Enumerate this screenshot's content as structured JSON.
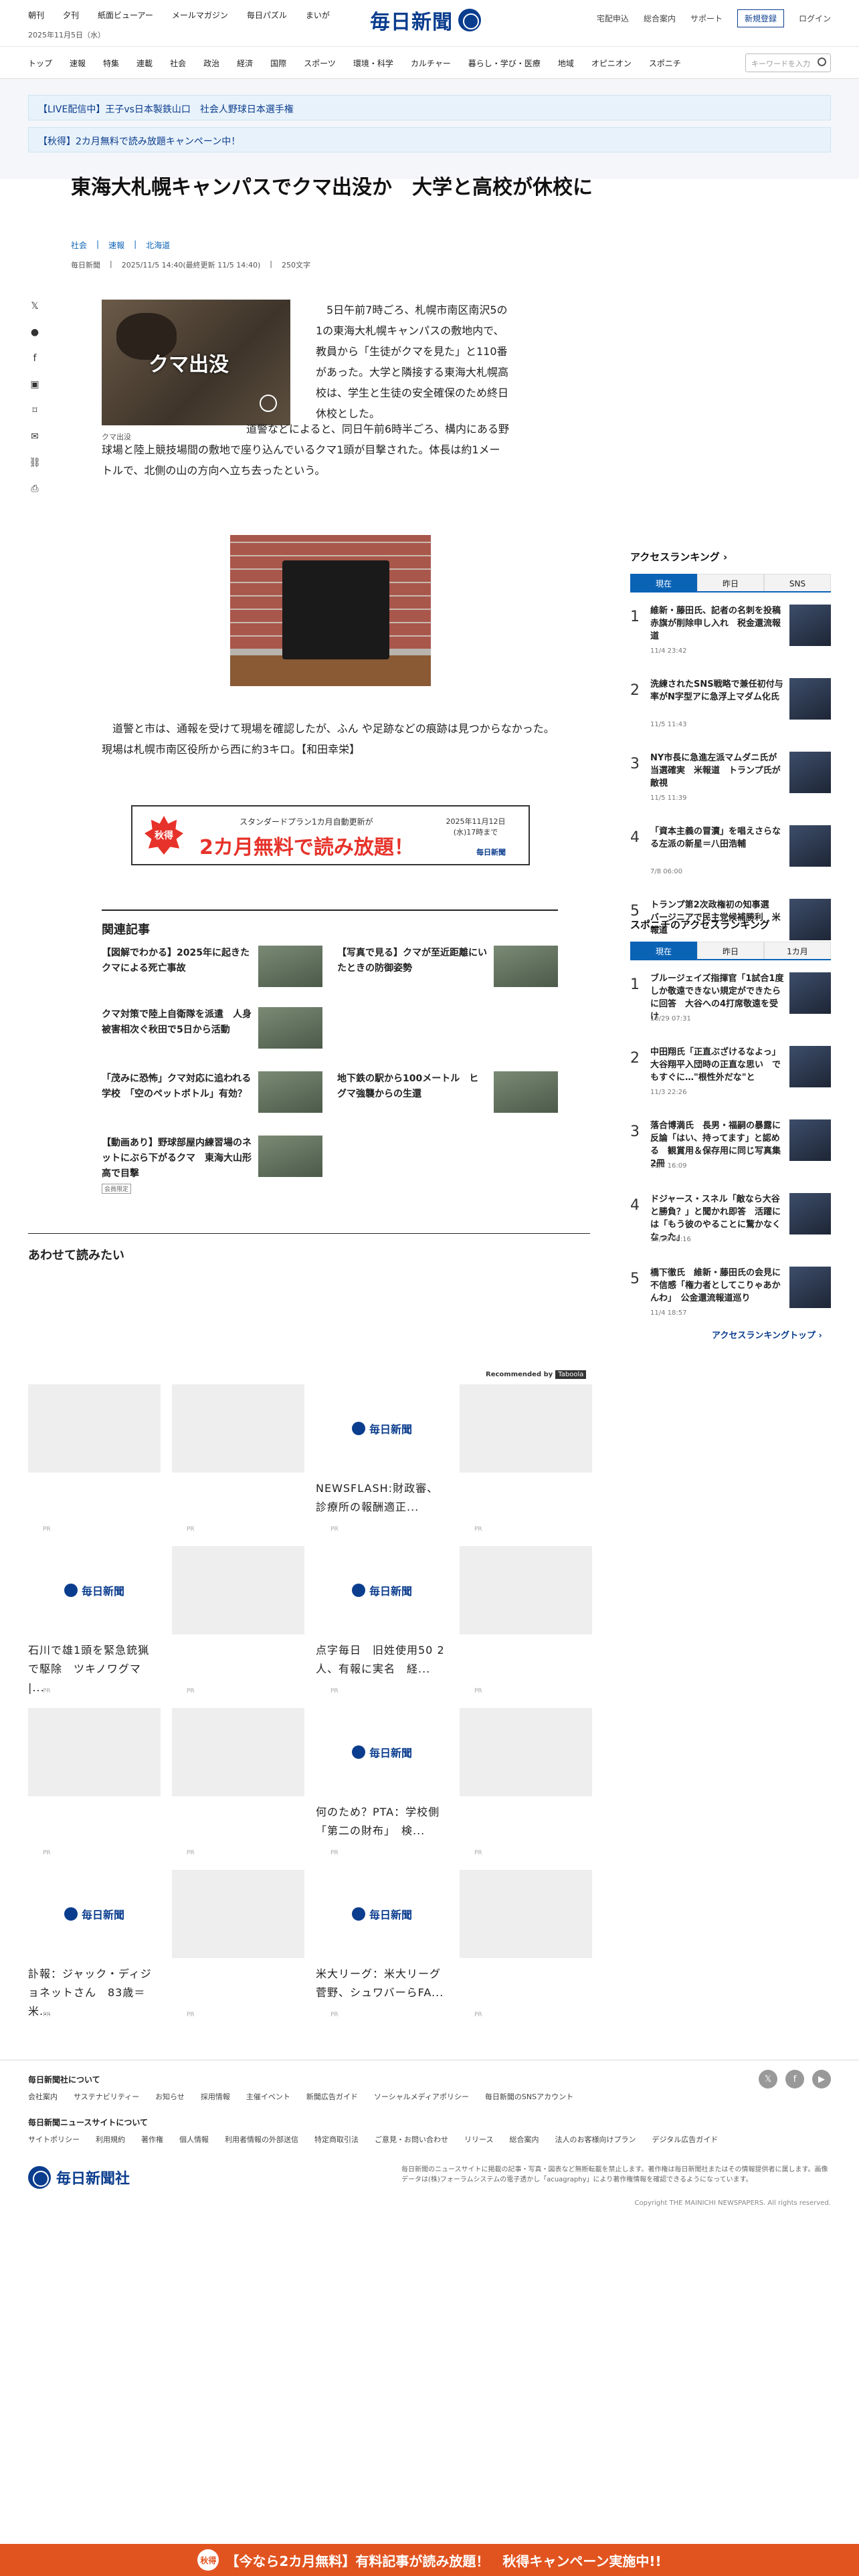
{
  "header": {
    "top_links": [
      "朝刊",
      "夕刊",
      "紙面ビューアー",
      "メールマガジン",
      "毎日パズル",
      "まいが"
    ],
    "date": "2025年11月5日（水）",
    "logo_text": "毎日新聞",
    "right_links": [
      "宅配申込",
      "総合案内",
      "サポート"
    ],
    "register": "新規登録",
    "login": "ログイン"
  },
  "nav": {
    "categories": [
      "トップ",
      "速報",
      "特集",
      "連載",
      "社会",
      "政治",
      "経済",
      "国際",
      "スポーツ",
      "環境・科学",
      "カルチャー",
      "暮らし・学び・医療",
      "地域",
      "オピニオン",
      "スポニチ"
    ],
    "search_placeholder": "キーワードを入力"
  },
  "banners": [
    "【LIVE配信中】王子vs日本製鉄山口　社会人野球日本選手権",
    "【秋得】2カ月無料で読み放題キャンペーン中！"
  ],
  "article": {
    "title": "東海大札幌キャンパスでクマ出没か　大学と高校が休校に",
    "tags": [
      "社会",
      "速報",
      "北海道"
    ],
    "source": "毎日新聞",
    "timestamp": "2025/11/5 14:40(最終更新 11/5 14:40)",
    "chars": "250文字",
    "photo_overlay": "クマ出没",
    "photo_caption": "クマ出没",
    "p1": "5日午前7時ごろ、札幌市南区南沢5の1の東海大札幌キャンパスの敷地内で、教員から「生徒がクマを見た」と110番があった。大学と隣接する東海大札幌高校は、学生と生徒の安全確保のため終日休校とした。",
    "p2": "道警などによると、同日午前6時半ごろ、構内にある野球場と陸上競技場間の敷地で座り込んでいるクマ1頭が目撃された。体長は約1メートルで、北側の山の方向へ立ち去ったという。",
    "p3": "道警と市は、通報を受けて現場を確認したが、ふん や足跡などの痕跡は見つからなかった。現場は札幌市南区役所から西に約3キロ。【和田幸栄】"
  },
  "promo": {
    "badge": "秋得",
    "line1": "スタンダードプラン1カ月自動更新が",
    "main": "2カ月無料で読み放題！",
    "period": "2025年11月12日(水)17時まで",
    "brand": "毎日新聞"
  },
  "related": {
    "heading": "関連記事",
    "items": [
      {
        "title": "【図解でわかる】2025年に起きたクマによる死亡事故"
      },
      {
        "title": "【写真で見る】クマが至近距離にいたときの防御姿勢"
      },
      {
        "title": "クマ対策で陸上自衛隊を派遣　人身被害相次ぐ秋田で5日から活動"
      },
      {
        "title": "地下鉄の駅から100メートル　ヒグマ強襲からの生還"
      },
      {
        "title": "「茂みに恐怖」クマ対応に追われる学校　「空のペットボトル」有効？"
      },
      {
        "title": "【動画あり】野球部屋内練習場のネットにぶら下がるクマ　東海大山形高で目撃",
        "badge": "会員限定"
      }
    ]
  },
  "read_together": {
    "heading": "あわせて読みたい",
    "recommended_by": "Recommended by",
    "brand": "Taboola",
    "pr": "PR",
    "cards": [
      {
        "title": ""
      },
      {
        "title": ""
      },
      {
        "title": "NEWSFLASH:財政審、診療所の報酬適正..."
      },
      {
        "title": ""
      },
      {
        "title": "石川で雄1頭を緊急銃猟で駆除　ツキノワグマ |..."
      },
      {
        "title": ""
      },
      {
        "title": "点字毎日　旧姓使用50 2人、有報に実名　経..."
      },
      {
        "title": ""
      },
      {
        "title": ""
      },
      {
        "title": ""
      },
      {
        "title": "何のため？PTA：学校側「第二の財布」　検..."
      },
      {
        "title": ""
      },
      {
        "title": "訃報：ジャック・ディジョネットさん　83歳＝米..."
      },
      {
        "title": ""
      },
      {
        "title": "米大リーグ：米大リーグ 菅野、シュワバーらFA..."
      },
      {
        "title": ""
      }
    ]
  },
  "sidebar": {
    "ranking_title": "アクセスランキング",
    "tabs": [
      "現在",
      "昨日",
      "SNS"
    ],
    "ranking": [
      {
        "rank": "1",
        "title": "維新・藤田氏、記者の名刺を投稿　赤旗が削除申し入れ　税金還流報道",
        "time": "11/4 23:42"
      },
      {
        "rank": "2",
        "title": "洗練されたSNS戦略で兼任初付与率がN字型アに急浮上マダム化氏",
        "time": "11/5 11:43"
      },
      {
        "rank": "3",
        "title": "NY市長に急進左派マムダニ氏が当選確実　米報道　トランプ氏が敵視",
        "time": "11/5 11:39"
      },
      {
        "rank": "4",
        "title": "「資本主義の冒瀆」を唱えさらなる左派の新星＝八田浩輔",
        "time": "7/8 06:00"
      },
      {
        "rank": "5",
        "title": "トランプ第2次政権初の知事選　バージニアで民主党候補勝利　米報道",
        "time": "11/5 10:12"
      }
    ],
    "sponichi_title": "スポニチのアクセスランキング",
    "sponichi_tabs": [
      "現在",
      "昨日",
      "1カ月"
    ],
    "sponichi": [
      {
        "rank": "1",
        "title": "ブルージェイズ指揮官「1試合1度しか敬遠できない規定ができたらに回答　大谷への4打席敬遠を受け",
        "time": "10/29 07:31"
      },
      {
        "rank": "2",
        "title": "中田翔氏「正直ぶざけるなよっ」　大谷翔平入団時の正直な思い　でもすぐに…\"根性外だな\"と",
        "time": "11/3 22:26"
      },
      {
        "rank": "3",
        "title": "落合博満氏　長男・福嗣の暴露に反論「はい、持ってます」と認める　観賞用＆保存用に同じ写真集2冊",
        "time": "11/4 16:09"
      },
      {
        "rank": "4",
        "title": "ドジャース・スネル「敵なら大谷と勝負？」と聞かれ即答　活躍には「もう彼のやることに驚かなくなった」",
        "time": "10/29 06:16"
      },
      {
        "rank": "5",
        "title": "橋下徹氏　維新・藤田氏の会見に不信感「権力者としてこりゃあかんわ」　公金還流報道巡り",
        "time": "11/4 18:57"
      }
    ],
    "ranking_top": "アクセスランキングトップ"
  },
  "footer": {
    "about_title": "毎日新聞社について",
    "about_links": [
      "会社案内",
      "サステナビリティー",
      "お知らせ",
      "採用情報",
      "主催イベント",
      "新聞広告ガイド",
      "ソーシャルメディアポリシー",
      "毎日新聞のSNSアカウント"
    ],
    "site_title": "毎日新聞ニュースサイトについて",
    "site_links": [
      "サイトポリシー",
      "利用規約",
      "著作権",
      "個人情報",
      "利用者情報の外部送信",
      "特定商取引法",
      "ご意見・お問い合わせ",
      "リリース",
      "総合案内",
      "法人のお客様向けプラン",
      "デジタル広告ガイド"
    ],
    "logo": "毎日新聞社",
    "note": "毎日新聞のニュースサイトに掲載の記事・写真・図表など無断転載を禁止します。著作権は毎日新聞社またはその情報提供者に属します。画像データは(株)フォーラムシステムの電子透かし「acuagraphy」により著作権情報を確認できるようになっています。",
    "copyright": "Copyright THE MAINICHI NEWSPAPERS. All rights reserved."
  },
  "bottom_bar": {
    "badge": "秋得",
    "text": "【今なら2カ月無料】有料記事が読み放題！　秋得キャンペーン実施中!!"
  }
}
